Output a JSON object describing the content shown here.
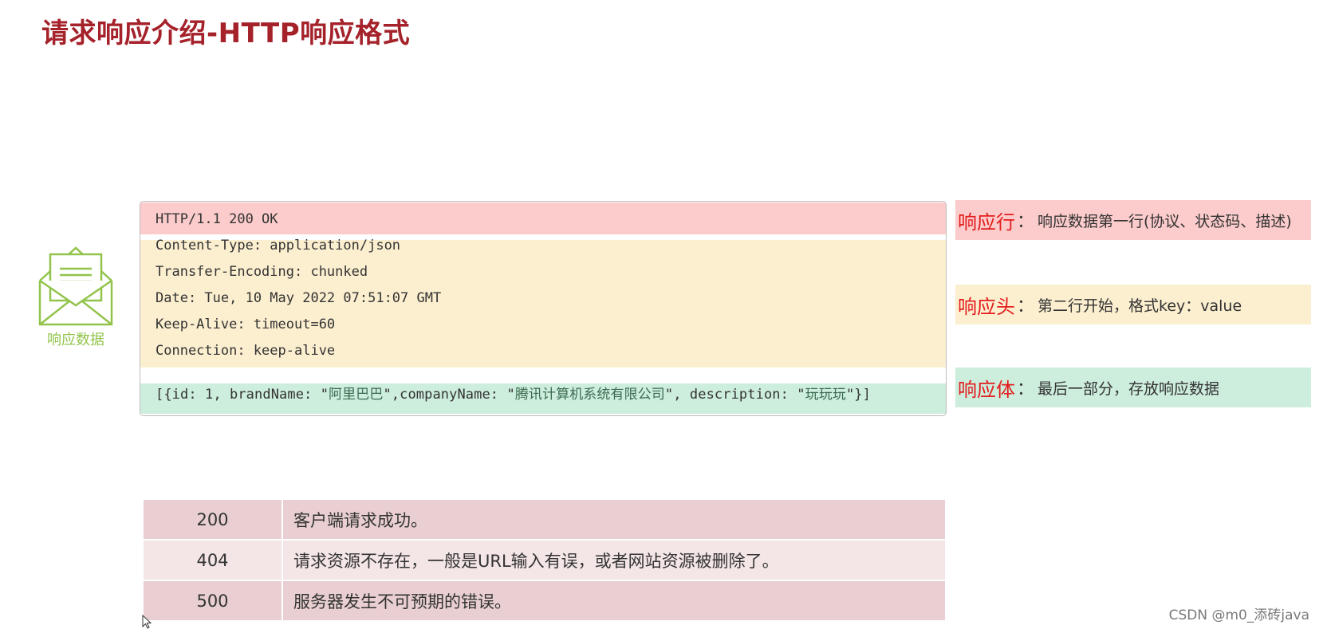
{
  "title": "请求响应介绍-HTTP响应格式",
  "envelope": {
    "icon": "envelope-letter-icon",
    "label": "响应数据",
    "color": "#92c44b"
  },
  "response": {
    "status_line": "HTTP/1.1 200 OK",
    "headers": [
      "Content-Type: application/json",
      "Transfer-Encoding: chunked",
      "Date: Tue, 10 May 2022 07:51:07 GMT",
      "Keep-Alive: timeout=60",
      "Connection: keep-alive"
    ],
    "body": {
      "p1": "[{id: 1, brandName: \"",
      "brand": "阿里巴巴",
      "p2": "\",companyName: \"",
      "company": "腾讯计算机系统有限公司",
      "p3": "\", description: \"",
      "desc": "玩玩玩",
      "p4": "\"}]"
    }
  },
  "labels": {
    "line": {
      "key": "响应行",
      "sep": "：",
      "desc": "响应数据第一行(协议、状态码、描述)"
    },
    "header": {
      "key": "响应头",
      "sep": "：",
      "desc": "第二行开始，格式key：value"
    },
    "body": {
      "key": "响应体",
      "sep": "：",
      "desc": "最后一部分，存放响应数据"
    }
  },
  "status_table": [
    {
      "code": "200",
      "desc": "客户端请求成功。"
    },
    {
      "code": "404",
      "desc": "请求资源不存在，一般是URL输入有误，或者网站资源被删除了。"
    },
    {
      "code": "500",
      "desc": "服务器发生不可预期的错误。"
    }
  ],
  "watermark": "CSDN @m0_添砖java",
  "colors": {
    "title": "#a5222b",
    "status_line_bg": "#fccbcb",
    "headers_bg": "#fcefd0",
    "body_bg": "#cdeddd",
    "label_key": "#e31e1e",
    "table_row_dark": "#e9cfd1",
    "table_row_light": "#f4e5e6"
  }
}
